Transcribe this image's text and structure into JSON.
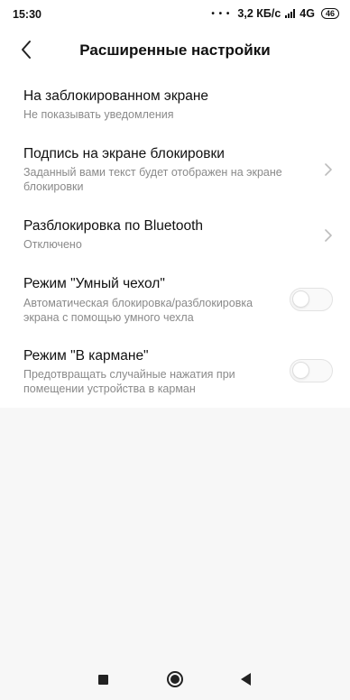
{
  "status_bar": {
    "time": "15:30",
    "dots": "• • •",
    "speed": "3,2 КБ/с",
    "network": "4G",
    "battery": "46"
  },
  "header": {
    "title": "Расширенные настройки",
    "back_icon": "chevron-left-icon"
  },
  "settings": [
    {
      "title": "На заблокированном экране",
      "subtitle": "Не показывать уведомления",
      "control": "none"
    },
    {
      "title": "Подпись на экране блокировки",
      "subtitle_line1": "Заданный вами текст будет отображен на экране",
      "subtitle_line2": "блокировки",
      "control": "chevron"
    },
    {
      "title": "Разблокировка по Bluetooth",
      "subtitle": "Отключено",
      "control": "chevron"
    },
    {
      "title": "Режим \"Умный чехол\"",
      "subtitle_line1": "Автоматическая блокировка/разблокировка",
      "subtitle_line2": "экрана с помощью умного чехла",
      "control": "toggle",
      "enabled": false
    },
    {
      "title": "Режим \"В кармане\"",
      "subtitle_line1": "Предотвращать случайные нажатия при",
      "subtitle_line2": "помещении устройства в карман",
      "control": "toggle",
      "enabled": false
    }
  ],
  "nav_bar": {
    "buttons": [
      "recents-square-icon",
      "home-circle-icon",
      "back-triangle-icon"
    ]
  },
  "colors": {
    "background": "#f7f7f7",
    "surface": "#ffffff",
    "text_primary": "#111111",
    "text_secondary": "#8a8a8a",
    "toggle_off_border": "#e2e2e2"
  }
}
